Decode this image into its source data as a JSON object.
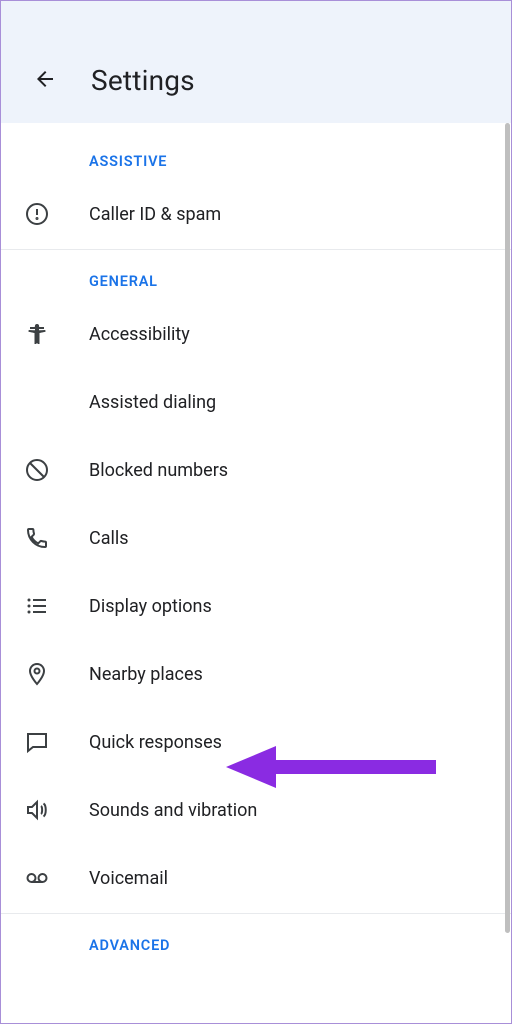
{
  "header": {
    "title": "Settings"
  },
  "sections": {
    "assistive": {
      "header": "ASSISTIVE",
      "caller_id": "Caller ID & spam"
    },
    "general": {
      "header": "GENERAL",
      "accessibility": "Accessibility",
      "assisted_dialing": "Assisted dialing",
      "blocked_numbers": "Blocked numbers",
      "calls": "Calls",
      "display_options": "Display options",
      "nearby_places": "Nearby places",
      "quick_responses": "Quick responses",
      "sounds_vibration": "Sounds and vibration",
      "voicemail": "Voicemail"
    },
    "advanced": {
      "header": "ADVANCED"
    }
  }
}
